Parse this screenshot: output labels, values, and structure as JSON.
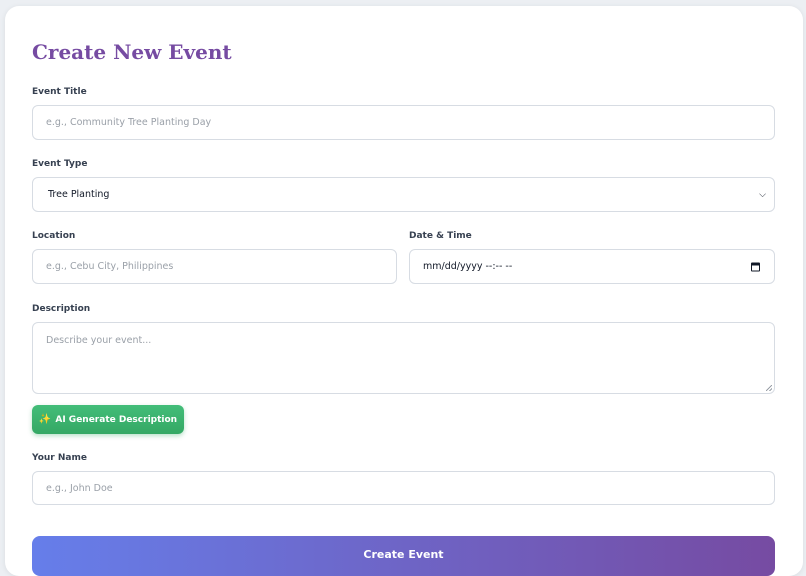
{
  "form": {
    "title": "Create New Event",
    "event_title": {
      "label": "Event Title",
      "placeholder": "e.g., Community Tree Planting Day"
    },
    "event_type": {
      "label": "Event Type",
      "value": "Tree Planting"
    },
    "location": {
      "label": "Location",
      "placeholder": "e.g., Cebu City, Philippines"
    },
    "datetime": {
      "label": "Date & Time",
      "placeholder": "mm/dd/yyyy --:-- --"
    },
    "description": {
      "label": "Description",
      "placeholder": "Describe your event..."
    },
    "ai_button": {
      "icon": "ai-sparkle-icon",
      "label": "AI Generate Description"
    },
    "your_name": {
      "label": "Your Name",
      "placeholder": "e.g., John Doe"
    },
    "submit_label": "Create Event"
  },
  "colors": {
    "title": "#764ba2",
    "ai_button": "#3cb371",
    "submit_gradient_start": "#667eea",
    "submit_gradient_end": "#764ba2"
  }
}
